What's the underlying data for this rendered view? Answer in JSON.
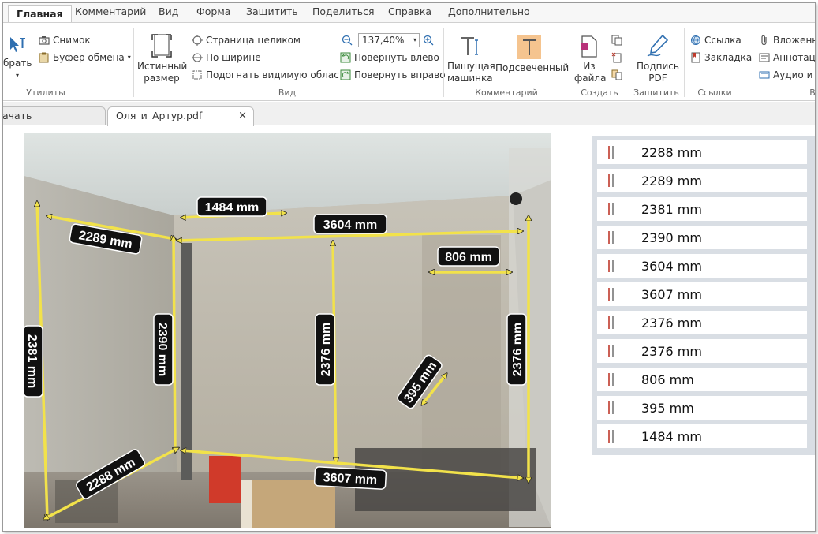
{
  "menu": {
    "tabs": [
      "Главная",
      "Комментарий",
      "Вид",
      "Форма",
      "Защитить",
      "Поделиться",
      "Справка",
      "Дополнительно"
    ]
  },
  "ribbon": {
    "groups": {
      "utils": "Утилиты",
      "view": "Вид",
      "comment": "Комментарий",
      "create": "Создать",
      "protect": "Защитить",
      "links": "Ссылки",
      "partial": "В"
    },
    "select_label": "брать",
    "snapshot": "Снимок",
    "clipboard": "Буфер обмена",
    "actual_size_1": "Истинный",
    "actual_size_2": "размер",
    "fit_page": "Страница целиком",
    "fit_width": "По ширине",
    "fit_visible": "Подогнать видимую область",
    "zoom_value": "137,40%",
    "rotate_left": "Повернуть влево",
    "rotate_right": "Повернуть вправо",
    "typewriter_1": "Пишущая",
    "typewriter_2": "машинка",
    "highlighted": "Подсвеченный",
    "from_file_1": "Из",
    "from_file_2": "файла",
    "sign_pdf_1": "Подпись",
    "sign_pdf_2": "PDF",
    "link": "Ссылка",
    "bookmark": "Закладка",
    "attach": "Вложенн",
    "annotation": "Аннотац",
    "audio": "Аудио и"
  },
  "doc_tabs": {
    "start": "ачать",
    "file": "Оля_и_Артур.pdf",
    "close": "×"
  },
  "photo": {
    "labels": {
      "a": "1484 mm",
      "b": "3604 mm",
      "c": "2289 mm",
      "d": "806 mm",
      "e": "2381 mm",
      "f": "2390 mm",
      "g": "2376 mm",
      "h": "2376 mm",
      "i": "395 mm",
      "j": "2288 mm",
      "k": "3607 mm"
    }
  },
  "measurements": [
    "2288 mm",
    "2289 mm",
    "2381 mm",
    "2390 mm",
    "3604 mm",
    "3607 mm",
    "2376 mm",
    "2376 mm",
    "806 mm",
    "395 mm",
    "1484 mm"
  ],
  "colors": {
    "arrow": "#f2e24a",
    "label_bg": "#111111",
    "list_bg": "#d9dee4",
    "accent_red": "#c0392b"
  }
}
